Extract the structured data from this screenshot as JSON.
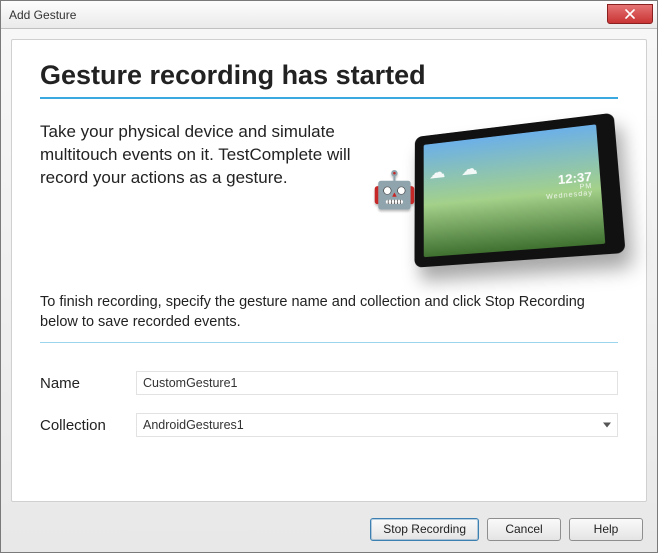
{
  "window": {
    "title": "Add Gesture"
  },
  "heading": "Gesture recording has started",
  "intro": "Take your physical device and simulate multitouch events on it. TestComplete will record your actions as a gesture.",
  "device_clock": {
    "time": "12:37",
    "pm": "PM",
    "day": "Wednesday"
  },
  "instruction": "To finish recording, specify the gesture name and collection and click Stop Recording below to save recorded events.",
  "form": {
    "name_label": "Name",
    "name_value": "CustomGesture1",
    "collection_label": "Collection",
    "collection_value": "AndroidGestures1"
  },
  "buttons": {
    "stop": "Stop Recording",
    "cancel": "Cancel",
    "help": "Help"
  }
}
